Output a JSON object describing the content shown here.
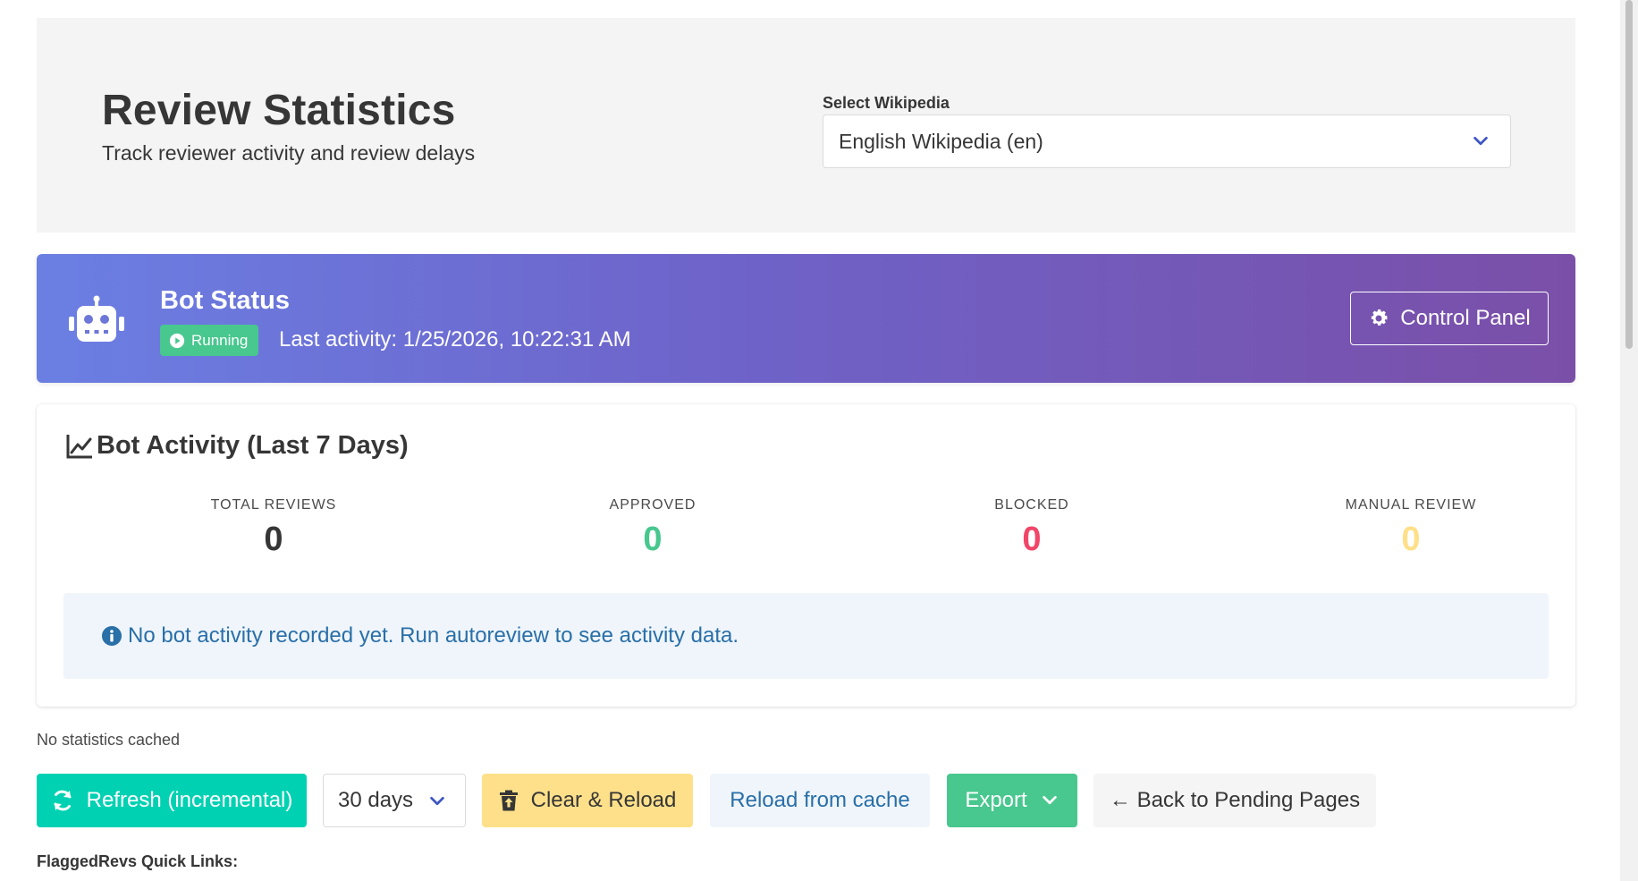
{
  "hero": {
    "title": "Review Statistics",
    "subtitle": "Track reviewer activity and review delays",
    "select_label": "Select Wikipedia",
    "select_value": "English Wikipedia (en)"
  },
  "bot_status": {
    "title": "Bot Status",
    "state": "Running",
    "last_activity": "Last activity: 1/25/2026, 10:22:31 AM",
    "control_panel_label": "Control Panel",
    "icon": "robot-icon"
  },
  "activity": {
    "title": "Bot Activity (Last 7 Days)",
    "stats": [
      {
        "label": "TOTAL REVIEWS",
        "value": "0",
        "color": "#363636"
      },
      {
        "label": "APPROVED",
        "value": "0",
        "color": "#48c78e"
      },
      {
        "label": "BLOCKED",
        "value": "0",
        "color": "#f14668"
      },
      {
        "label": "MANUAL REVIEW",
        "value": "0",
        "color": "#ffe08a"
      }
    ],
    "info_message": "No bot activity recorded yet. Run autoreview to see activity data."
  },
  "cache_note": "No statistics cached",
  "actions": {
    "refresh_label": "Refresh (incremental)",
    "days_value": "30 days",
    "clear_label": "Clear & Reload",
    "reload_cache_label": "Reload from cache",
    "export_label": "Export",
    "back_label": "← Back to Pending Pages"
  },
  "quick_links_label": "FlaggedRevs Quick Links:",
  "colors": {
    "primary_teal": "#00d1b2",
    "success": "#48c78e",
    "danger": "#f14668",
    "warning": "#ffe08a",
    "info_text": "#296fa8",
    "link_blue": "#3e56c4"
  }
}
